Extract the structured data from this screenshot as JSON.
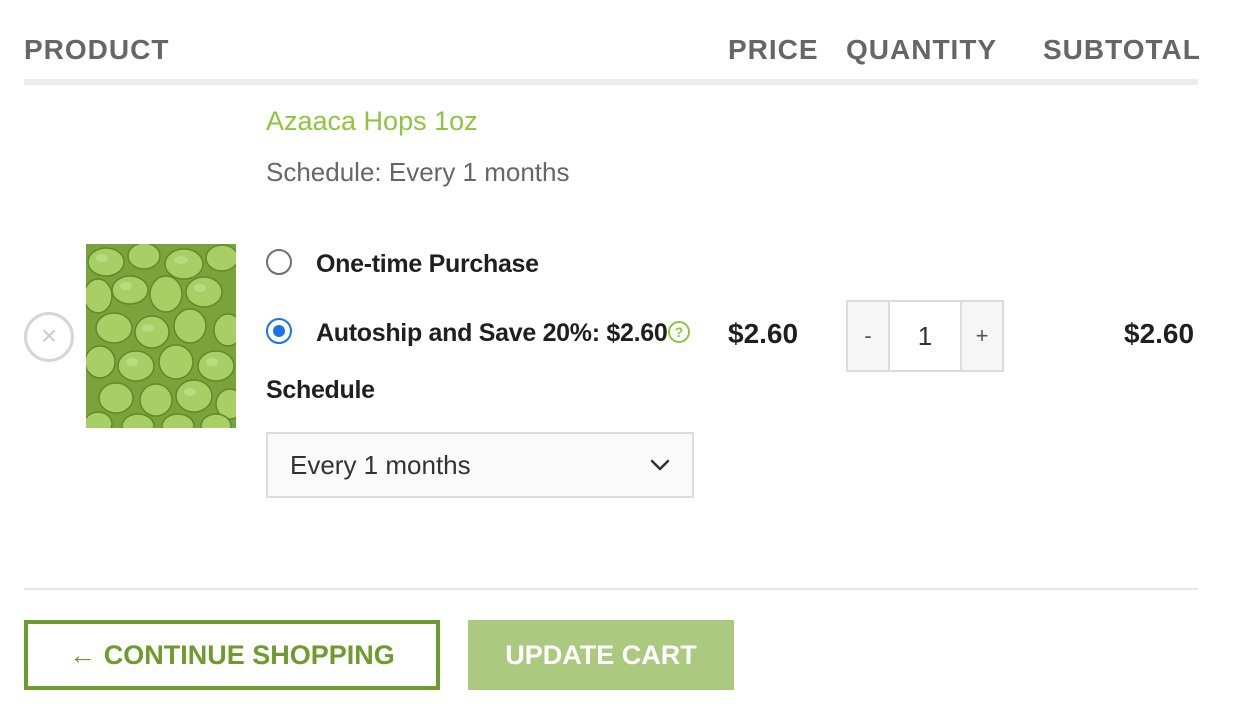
{
  "table_header": {
    "product": "PRODUCT",
    "price": "PRICE",
    "quantity": "QUANTITY",
    "subtotal": "SUBTOTAL"
  },
  "cart_item": {
    "name": "Azaaca Hops 1oz",
    "schedule_summary": "Schedule: Every 1 months",
    "remove_icon": "close-circle-icon",
    "remove_glyph": "×",
    "options": {
      "one_time_label": "One-time Purchase",
      "one_time_selected": false,
      "autoship_label": "Autoship and Save 20%: $2.60",
      "autoship_selected": true,
      "help_glyph": "?"
    },
    "schedule_label": "Schedule",
    "schedule_selected": "Every 1 months",
    "price": "$2.60",
    "quantity": {
      "minus": "-",
      "value": "1",
      "plus": "+"
    },
    "subtotal": "$2.60"
  },
  "actions": {
    "continue_shopping": "← CONTINUE SHOPPING",
    "update_cart": "UPDATE CART"
  },
  "colors": {
    "accent_green": "#8cc63f",
    "button_green": "#6e9b2d",
    "update_button_bg": "#abc97f",
    "radio_blue": "#1a73e8"
  }
}
